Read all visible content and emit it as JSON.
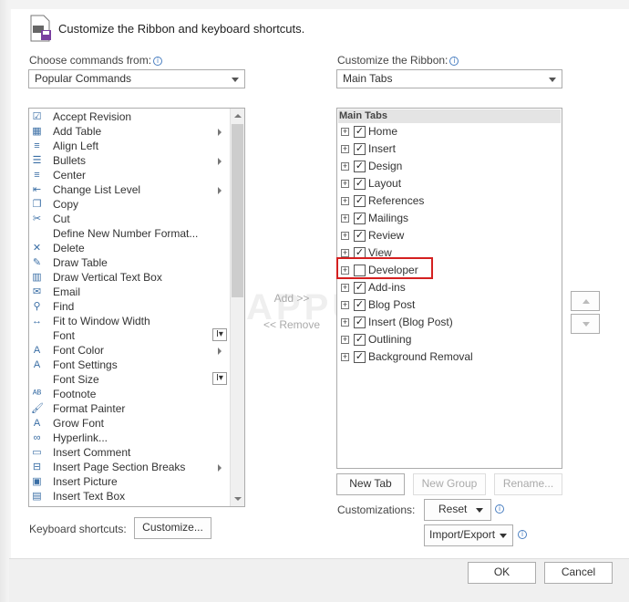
{
  "header": {
    "title": "Customize the Ribbon and keyboard shortcuts.",
    "icon": "save-ribbon-icon"
  },
  "left": {
    "label": "Choose commands from:",
    "selected": "Popular Commands",
    "items": [
      {
        "label": "Accept Revision",
        "icon": "check-doc-icon",
        "sub": false
      },
      {
        "label": "Add Table",
        "icon": "table-icon",
        "sub": true
      },
      {
        "label": "Align Left",
        "icon": "align-left-icon",
        "sub": false
      },
      {
        "label": "Bullets",
        "icon": "bullets-icon",
        "sub": true
      },
      {
        "label": "Center",
        "icon": "center-icon",
        "sub": false
      },
      {
        "label": "Change List Level",
        "icon": "list-level-icon",
        "sub": true
      },
      {
        "label": "Copy",
        "icon": "copy-icon",
        "sub": false
      },
      {
        "label": "Cut",
        "icon": "scissors-icon",
        "sub": false
      },
      {
        "label": "Define New Number Format...",
        "icon": "",
        "sub": false
      },
      {
        "label": "Delete",
        "icon": "delete-icon",
        "sub": false
      },
      {
        "label": "Draw Table",
        "icon": "draw-table-icon",
        "sub": false
      },
      {
        "label": "Draw Vertical Text Box",
        "icon": "vertical-textbox-icon",
        "sub": false
      },
      {
        "label": "Email",
        "icon": "email-icon",
        "sub": false
      },
      {
        "label": "Find",
        "icon": "find-icon",
        "sub": false
      },
      {
        "label": "Fit to Window Width",
        "icon": "fit-width-icon",
        "sub": false
      },
      {
        "label": "Font",
        "icon": "",
        "sub": false
      },
      {
        "label": "Font Color",
        "icon": "font-color-icon",
        "sub": true
      },
      {
        "label": "Font Settings",
        "icon": "font-settings-icon",
        "sub": false
      },
      {
        "label": "Font Size",
        "icon": "",
        "sub": false
      },
      {
        "label": "Footnote",
        "icon": "footnote-icon",
        "sub": false
      },
      {
        "label": "Format Painter",
        "icon": "format-painter-icon",
        "sub": false
      },
      {
        "label": "Grow Font",
        "icon": "grow-font-icon",
        "sub": false
      },
      {
        "label": "Hyperlink...",
        "icon": "hyperlink-icon",
        "sub": false
      },
      {
        "label": "Insert Comment",
        "icon": "comment-icon",
        "sub": false
      },
      {
        "label": "Insert Page  Section Breaks",
        "icon": "page-break-icon",
        "sub": true
      },
      {
        "label": "Insert Picture",
        "icon": "picture-icon",
        "sub": false
      },
      {
        "label": "Insert Text Box",
        "icon": "textbox-icon",
        "sub": false
      }
    ]
  },
  "middle": {
    "add": "Add >>",
    "remove": "<< Remove"
  },
  "right": {
    "label": "Customize the Ribbon:",
    "selected": "Main Tabs",
    "header": "Main Tabs",
    "items": [
      {
        "label": "Home",
        "checked": true
      },
      {
        "label": "Insert",
        "checked": true
      },
      {
        "label": "Design",
        "checked": true
      },
      {
        "label": "Layout",
        "checked": true
      },
      {
        "label": "References",
        "checked": true
      },
      {
        "label": "Mailings",
        "checked": true
      },
      {
        "label": "Review",
        "checked": true
      },
      {
        "label": "View",
        "checked": true
      },
      {
        "label": "Developer",
        "checked": false
      },
      {
        "label": "Add-ins",
        "checked": true
      },
      {
        "label": "Blog Post",
        "checked": true
      },
      {
        "label": "Insert (Blog Post)",
        "checked": true
      },
      {
        "label": "Outlining",
        "checked": true
      },
      {
        "label": "Background Removal",
        "checked": true
      }
    ]
  },
  "buttons": {
    "new_tab": "New Tab",
    "new_group": "New Group",
    "rename": "Rename...",
    "customizations": "Customizations:",
    "reset": "Reset",
    "import_export": "Import/Export",
    "keyboard": "Keyboard shortcuts:",
    "customize": "Customize...",
    "ok": "OK",
    "cancel": "Cancel"
  },
  "colors": {
    "highlight": "#d42020",
    "checkbox_accent": "#3a6ea5"
  }
}
